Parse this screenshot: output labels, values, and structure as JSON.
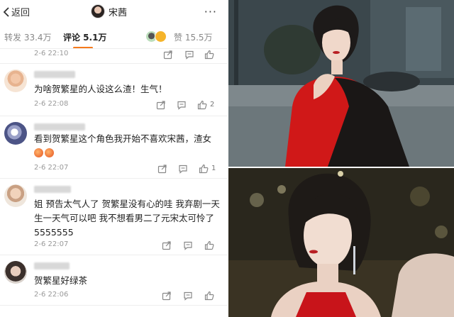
{
  "header": {
    "back_label": "返回",
    "title": "宋茜",
    "more": "···"
  },
  "tabs": [
    {
      "label": "转发 33.4万"
    },
    {
      "label": "评论 5.1万"
    },
    {
      "label": "赞 15.5万"
    }
  ],
  "comments": [
    {
      "time": "2-6 22:10",
      "text": "",
      "likes": ""
    },
    {
      "time": "2-6 22:08",
      "text": "为啥贺繁星的人设这么渣！生气！",
      "likes": "2"
    },
    {
      "time": "2-6 22:07",
      "text": "看到贺繁星这个角色我开始不喜欢宋茜，渣女",
      "likes": "1"
    },
    {
      "time": "2-6 22:07",
      "text": "姐 预告太气人了 贺繁星没有心的哇 我弃剧一天 生一天气可以吧 我不想看男二了元宋太可怜了5555555",
      "likes": ""
    },
    {
      "time": "2-6 22:06",
      "text": "贺繁星好绿茶",
      "likes": ""
    }
  ],
  "colors": {
    "accent": "#f57a1c",
    "dress_red": "#d01818"
  },
  "icons": [
    "chevron-left-icon",
    "more-icon",
    "share-icon",
    "comment-icon",
    "thumbs-up-icon"
  ]
}
